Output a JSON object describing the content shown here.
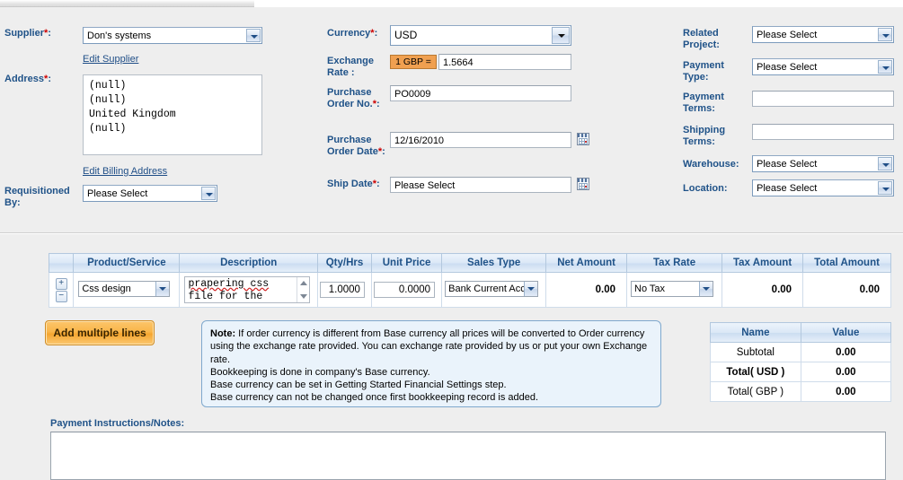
{
  "left_column": {
    "supplier_label": "Supplier",
    "supplier_value": "Don's systems",
    "edit_supplier_link": "Edit Supplier",
    "address_label": "Address",
    "address_lines": "(null)\n(null)\nUnited Kingdom\n(null)",
    "edit_billing_link": "Edit Billing Address",
    "requisitioned_by_label": "Requisitioned By:",
    "requisitioned_by_value": "Please Select"
  },
  "mid_column": {
    "currency_label": "Currency",
    "currency_value": "USD",
    "exchange_rate_label": "Exchange Rate :",
    "exchange_rate_badge": "1 GBP =",
    "exchange_rate_value": "1.5664",
    "po_no_label": "Purchase Order No.",
    "po_no_value": "PO0009",
    "po_date_label": "Purchase Order Date",
    "po_date_value": "12/16/2010",
    "ship_date_label": "Ship Date",
    "ship_date_value": "Please Select"
  },
  "right_column": {
    "related_project_label": "Related Project:",
    "related_project_value": "Please Select",
    "payment_type_label": "Payment Type:",
    "payment_type_value": "Please Select",
    "payment_terms_label": "Payment Terms:",
    "payment_terms_value": "",
    "shipping_terms_label": "Shipping Terms:",
    "shipping_terms_value": "",
    "warehouse_label": "Warehouse:",
    "warehouse_value": "Please Select",
    "location_label": "Location:",
    "location_value": "Please Select"
  },
  "line_items": {
    "headers": [
      "",
      "Product/Service",
      "Description",
      "Qty/Hrs",
      "Unit Price",
      "Sales Type",
      "Net Amount",
      "Tax Rate",
      "Tax Amount",
      "Total Amount"
    ],
    "add_row_button": "+",
    "remove_row_button": "−",
    "rows": [
      {
        "product": "Css design",
        "description_line1": "prapering css",
        "description_line2": "file for the",
        "qty": "1.0000",
        "unit_price": "0.0000",
        "sales_type": "Bank Current Accou",
        "net_amount": "0.00",
        "tax_rate": "No Tax",
        "tax_amount": "0.00",
        "total_amount": "0.00"
      }
    ]
  },
  "add_multiple_lines_button": "Add multiple lines",
  "note": {
    "bold_prefix": "Note:",
    "p1": " If order currency is different from Base currency all prices will be converted to Order currency using the exchange rate provided. You can exchange rate provided by us or put your own Exchange rate.",
    "p2": "Bookkeeping is done in company's Base currency.",
    "p3": "Base currency can be set in Getting Started Financial Settings step.",
    "p4": "Base currency can not be changed once first bookkeeping record is added."
  },
  "totals": {
    "header_name": "Name",
    "header_value": "Value",
    "rows": [
      {
        "name": "Subtotal",
        "value": "0.00"
      },
      {
        "name": "Total( USD )",
        "value": "0.00"
      },
      {
        "name": "Total( GBP )",
        "value": "0.00"
      }
    ]
  },
  "payment_notes": {
    "label": "Payment Instructions/Notes:",
    "value": ""
  },
  "colors": {
    "label_blue": "#1f5288",
    "required_red": "#cc0000",
    "accent_orange": "#f0a050",
    "panel_bg": "#eeeeee",
    "table_header_blue": "#dae7f6",
    "note_bg": "#eaf3fb"
  }
}
